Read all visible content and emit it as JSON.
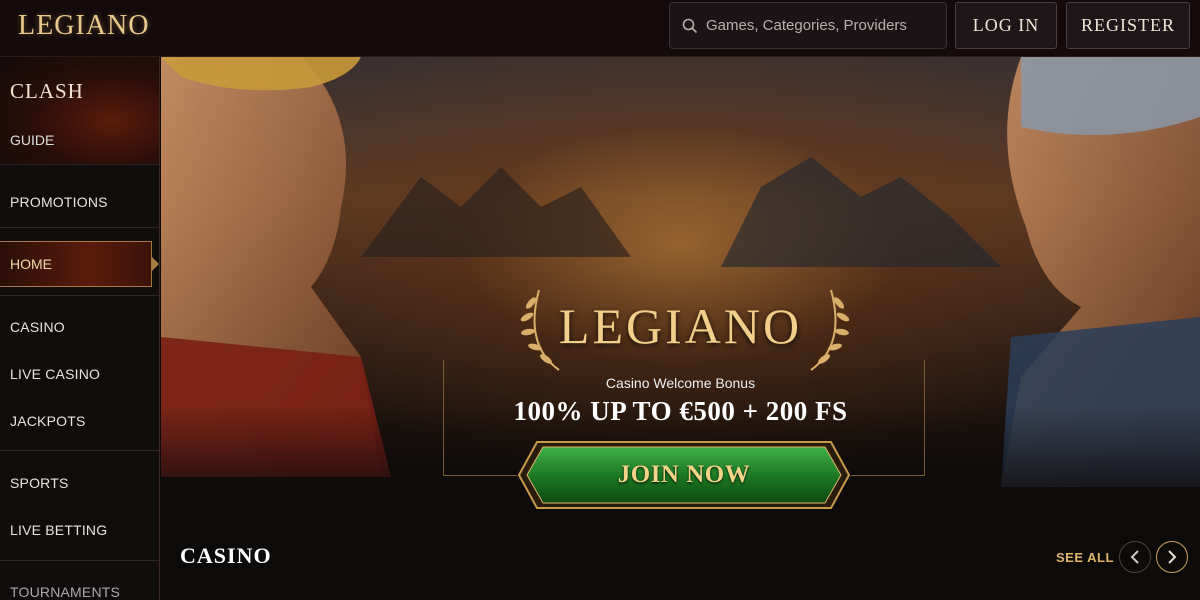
{
  "header": {
    "logo": "LEGIANO",
    "search_placeholder": "Games, Categories, Providers",
    "login_label": "LOG IN",
    "register_label": "REGISTER"
  },
  "sidebar": {
    "clash": {
      "title": "CLASH",
      "subtitle": "GUIDE"
    },
    "items": [
      {
        "label": "PROMOTIONS"
      },
      {
        "label": "HOME",
        "active": true
      },
      {
        "label": "CASINO"
      },
      {
        "label": "LIVE CASINO"
      },
      {
        "label": "JACKPOTS"
      },
      {
        "label": "SPORTS"
      },
      {
        "label": "LIVE BETTING"
      },
      {
        "label": "TOURNAMENTS"
      }
    ]
  },
  "hero": {
    "logo": "LEGIANO",
    "subtitle": "Casino Welcome Bonus",
    "offer": "100% UP TO €500 + 200 FS",
    "cta_label": "JOIN NOW"
  },
  "casino_section": {
    "title": "CASINO",
    "see_all_label": "SEE ALL"
  },
  "colors": {
    "accent_gold": "#e0b56a",
    "cta_green": "#1f8a2a",
    "background": "#0d0a0a"
  },
  "icons": [
    "search-icon",
    "laurel-left-icon",
    "laurel-right-icon",
    "chevron-left-icon",
    "chevron-right-icon"
  ]
}
